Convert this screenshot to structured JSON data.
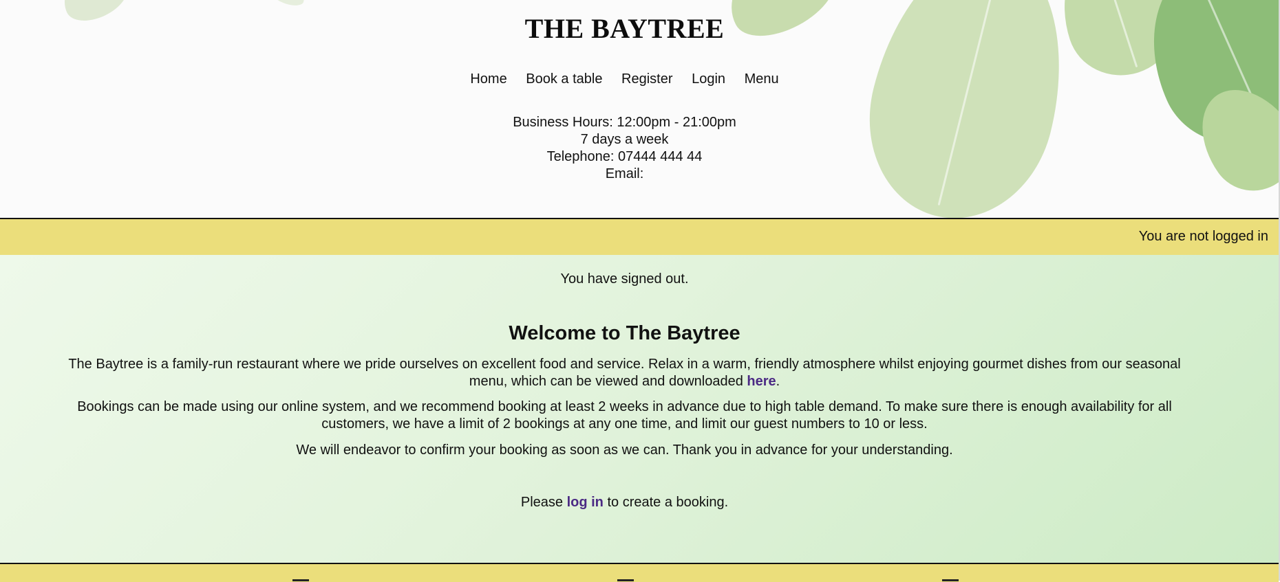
{
  "brand": {
    "title": "THE BAYTREE"
  },
  "nav": {
    "items": [
      {
        "label": "Home"
      },
      {
        "label": "Book a table"
      },
      {
        "label": "Register"
      },
      {
        "label": "Login"
      },
      {
        "label": "Menu"
      }
    ]
  },
  "business_info": {
    "hours": "Business Hours: 12:00pm - 21:00pm",
    "days": "7 days a week",
    "telephone": "Telephone: 07444 444 44",
    "email": "Email:"
  },
  "status_bar": {
    "text": "You are not logged in",
    "color": "#ebde7b"
  },
  "main": {
    "flash_message": "You have signed out.",
    "heading": "Welcome to The Baytree",
    "paragraph1_text": "The Baytree is a family-run restaurant where we pride ourselves on excellent food and service. Relax in a warm, friendly atmosphere whilst enjoying gourmet dishes from our seasonal menu, which can be viewed and downloaded ",
    "paragraph1_link": "here",
    "paragraph1_end": ".",
    "paragraph2": "Bookings can be made using our online system, and we recommend booking at least 2 weeks in advance due to high table demand. To make sure there is enough availability for all customers, we have a limit of 2 bookings at any one time, and limit our guest numbers to 10 or less.",
    "paragraph3": "We will endeavor to confirm your booking as soon as we can. Thank you in advance for your understanding.",
    "login_prefix": "Please ",
    "login_link": "log in",
    "login_suffix": " to create a booking."
  },
  "colors": {
    "accent_yellow": "#ebde7b",
    "link_purple": "#4b2a84",
    "main_bg_start": "#eef9ea",
    "main_bg_end": "#cdebc6"
  },
  "footer": {
    "icons": [
      "footer-icon-left",
      "footer-icon-center",
      "footer-icon-right"
    ]
  }
}
